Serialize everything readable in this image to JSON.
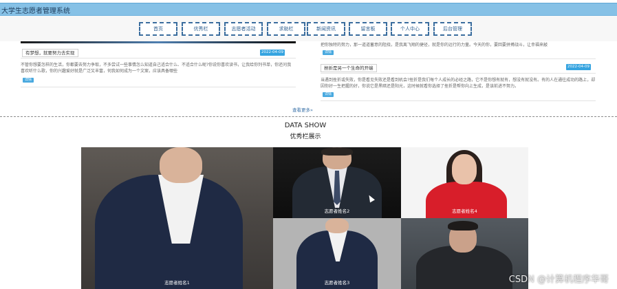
{
  "app": {
    "title": "大学生志愿者管理系统"
  },
  "nav": {
    "items": [
      {
        "label": "首页"
      },
      {
        "label": "优秀栏"
      },
      {
        "label": "志愿者活动"
      },
      {
        "label": "求助栏"
      },
      {
        "label": "新闻资讯"
      },
      {
        "label": "留言板"
      },
      {
        "label": "个人中心"
      },
      {
        "label": "后台管理"
      }
    ]
  },
  "news": {
    "left": {
      "title": "有梦想，就要努力去实现",
      "date": "2022-04-09",
      "text": "不管你想要怎样的生活，你都要去努力争取，不多尝试一些事情怎么知道自己适合什么、不适合什么呢?你说你喜欢读书，让我给你列书单，你还问我喜欢听什么歌，你的兴趣爱好就是广泛又丰富，何我如何成为一个文案，应该具备哪些",
      "button": "详情"
    },
    "right": {
      "top_text": "把你独特的努力，那一道道蓄意的阻挠，是我离飞翔的捷径，就是你的远行的力量。今天的你，要回要拼搏战斗，让幸福来敲",
      "top_button": "详情",
      "title": "挫折是另一个生命的开端",
      "date": "2022-04-09",
      "text": "当遇到挫折或失败，你是看见失败还是看到机会?挫折是我们每个人成长的必经之路，它不是你想有就有，想没有就没有。有的人在通往成功的路上，却因你好一生把握的好，你说它是黑暗还是阳光，这时候就看你选择了挫折是帮你向上生成，是该前进不努力。",
      "button": "详情"
    },
    "more_label": "查看更多»"
  },
  "data_show": {
    "title": "DATA SHOW",
    "subtitle": "优秀栏展示",
    "tiles": [
      {
        "name": "志愿者姓名1"
      },
      {
        "name": "志愿者姓名2"
      },
      {
        "name": "志愿者姓名4"
      },
      {
        "name": "志愿者姓名3"
      },
      {
        "name": ""
      }
    ]
  },
  "watermark": "CSDN @计算机程序华哥",
  "colors": {
    "title_bar": "#86c1e6",
    "nav_border": "#3a6d9e",
    "date_badge": "#36a4e0"
  }
}
